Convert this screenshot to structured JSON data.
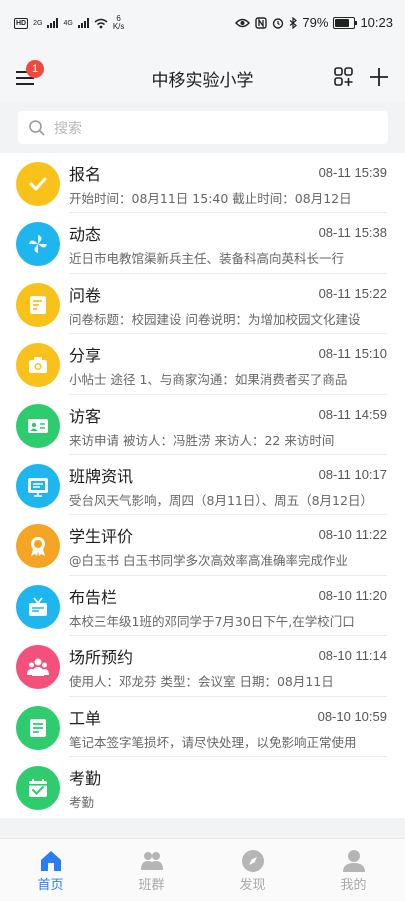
{
  "status_bar": {
    "hd_badge": "HD",
    "signal_label_1": "2G",
    "signal_label_2": "4G",
    "net_speed_value": "6",
    "net_speed_unit": "K/s",
    "battery_percent_text": "79%",
    "battery_level": 0.79,
    "time": "10:23"
  },
  "header": {
    "title": "中移实验小学",
    "notification_count": "1"
  },
  "search": {
    "placeholder": "搜索"
  },
  "items": [
    {
      "title": "报名",
      "time": "08-11 15:39",
      "desc": "开始时间：08月11日 15:40 截止时间：08月12日",
      "color": "#f9c21a",
      "icon": "check-icon"
    },
    {
      "title": "动态",
      "time": "08-11 15:38",
      "desc": "近日市电教馆渠新兵主任、装备科高向英科长一行",
      "color": "#1eb6ef",
      "icon": "pinwheel-icon"
    },
    {
      "title": "问卷",
      "time": "08-11 15:22",
      "desc": "问卷标题：校园建设 问卷说明：为增加校园文化建设",
      "color": "#f9c21a",
      "icon": "questionnaire-icon"
    },
    {
      "title": "分享",
      "time": "08-11 15:10",
      "desc": "小帖士 途径 1、与商家沟通：如果消费者买了商品",
      "color": "#f9c21a",
      "icon": "camera-icon"
    },
    {
      "title": "访客",
      "time": "08-11 14:59",
      "desc": "来访申请 被访人：冯胜涝 来访人：22 来访时间",
      "color": "#2ecc6e",
      "icon": "id-card-icon"
    },
    {
      "title": "班牌资讯",
      "time": "08-11 10:17",
      "desc": "受台风天气影响，周四（8月11日）、周五（8月12日）",
      "color": "#1eb6ef",
      "icon": "board-icon"
    },
    {
      "title": "学生评价",
      "time": "08-10 11:22",
      "desc": "@白玉书 白玉书同学多次高效率高准确率完成作业",
      "color": "#f5a524",
      "icon": "medal-icon"
    },
    {
      "title": "布告栏",
      "time": "08-10 11:20",
      "desc": "本校三年级1班的邓同学于7月30日下午,在学校门口",
      "color": "#1eb6ef",
      "icon": "notice-icon"
    },
    {
      "title": "场所预约",
      "time": "08-10 11:14",
      "desc": "使用人：邓龙芬 类型：会议室 日期：08月11日",
      "color": "#f3507b",
      "icon": "people-icon"
    },
    {
      "title": "工单",
      "time": "08-10 10:59",
      "desc": "笔记本签字笔损坏，请尽快处理，以免影响正常使用",
      "color": "#2ecc6e",
      "icon": "document-icon"
    },
    {
      "title": "考勤",
      "time": "",
      "desc": "考勤",
      "color": "#2ecc6e",
      "icon": "calendar-check-icon"
    }
  ],
  "tabs": [
    {
      "label": "首页",
      "icon": "home-icon",
      "active": true
    },
    {
      "label": "班群",
      "icon": "group-icon",
      "active": false
    },
    {
      "label": "发现",
      "icon": "compass-icon",
      "active": false
    },
    {
      "label": "我的",
      "icon": "person-icon",
      "active": false
    }
  ],
  "colors": {
    "accent": "#2a7ef5",
    "badge": "#f04a3f",
    "tab_inactive": "#a9a9a9"
  }
}
